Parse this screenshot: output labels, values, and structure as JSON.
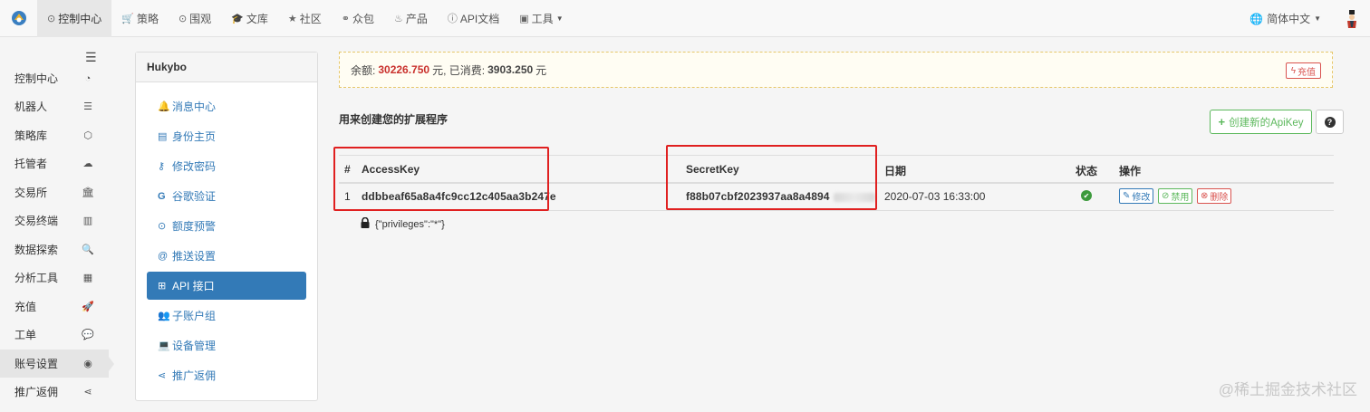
{
  "topnav": {
    "items": [
      {
        "label": "控制中心",
        "icon": "dashboard-icon",
        "active": true
      },
      {
        "label": "策略",
        "icon": "cart-icon"
      },
      {
        "label": "围观",
        "icon": "play-circle-icon"
      },
      {
        "label": "文库",
        "icon": "graduation-cap-icon"
      },
      {
        "label": "社区",
        "icon": "star-icon"
      },
      {
        "label": "众包",
        "icon": "link-icon"
      },
      {
        "label": "产品",
        "icon": "fire-icon"
      },
      {
        "label": "API文档",
        "icon": "info-circle-icon"
      },
      {
        "label": "工具",
        "icon": "briefcase-icon",
        "dropdown": true
      }
    ],
    "language": "简体中文"
  },
  "sidebar": {
    "items": [
      {
        "label": "控制中心",
        "icon": "gauge-icon"
      },
      {
        "label": "机器人",
        "icon": "server-icon"
      },
      {
        "label": "策略库",
        "icon": "cube-icon"
      },
      {
        "label": "托管者",
        "icon": "cloud-icon"
      },
      {
        "label": "交易所",
        "icon": "bank-icon"
      },
      {
        "label": "交易终端",
        "icon": "bar-chart-icon"
      },
      {
        "label": "数据探索",
        "icon": "search-plus-icon"
      },
      {
        "label": "分析工具",
        "icon": "calculator-icon"
      },
      {
        "label": "充值",
        "icon": "rocket-icon"
      },
      {
        "label": "工单",
        "icon": "comment-icon"
      },
      {
        "label": "账号设置",
        "icon": "user-circle-icon",
        "active": true
      },
      {
        "label": "推广返佣",
        "icon": "share-icon"
      }
    ]
  },
  "account": {
    "username": "Hukybo",
    "menu": [
      {
        "label": "消息中心",
        "icon": "bell-icon"
      },
      {
        "label": "身份主页",
        "icon": "id-card-icon"
      },
      {
        "label": "修改密码",
        "icon": "key-icon"
      },
      {
        "label": "谷歌验证",
        "icon": "google-icon"
      },
      {
        "label": "额度预警",
        "icon": "warning-circle-icon"
      },
      {
        "label": "推送设置",
        "icon": "at-icon"
      },
      {
        "label": "API 接口",
        "icon": "sitemap-icon",
        "active": true
      },
      {
        "label": "子账户组",
        "icon": "users-icon"
      },
      {
        "label": "设备管理",
        "icon": "laptop-icon"
      },
      {
        "label": "推广返佣",
        "icon": "share-icon"
      }
    ]
  },
  "balance": {
    "balance_label": "余额:",
    "balance_value": "30226.750",
    "unit": "元",
    "spent_label": ", 已消费:",
    "spent_value": "3903.250",
    "recharge_label": "充值"
  },
  "api": {
    "section_title": "用来创建您的扩展程序",
    "create_label": "创建新的ApiKey",
    "columns": [
      "#",
      "AccessKey",
      "SecretKey",
      "日期",
      "状态",
      "操作"
    ],
    "rows": [
      {
        "index": "1",
        "access_key": "ddbbeaf65a8a4fc9cc12c405aa3b247e",
        "secret_key": "f88b07cbf2023937aa8a4894",
        "date": "2020-07-03 16:33:00",
        "status": "enabled",
        "actions": {
          "edit": "修改",
          "disable": "禁用",
          "delete": "删除"
        }
      }
    ],
    "privileges": "{\"privileges\":\"*\"}"
  },
  "watermark": "@稀土掘金技术社区",
  "colors": {
    "primary": "#337ab7",
    "success": "#5cb85c",
    "danger": "#d9534f",
    "highlight": "#e02020"
  }
}
